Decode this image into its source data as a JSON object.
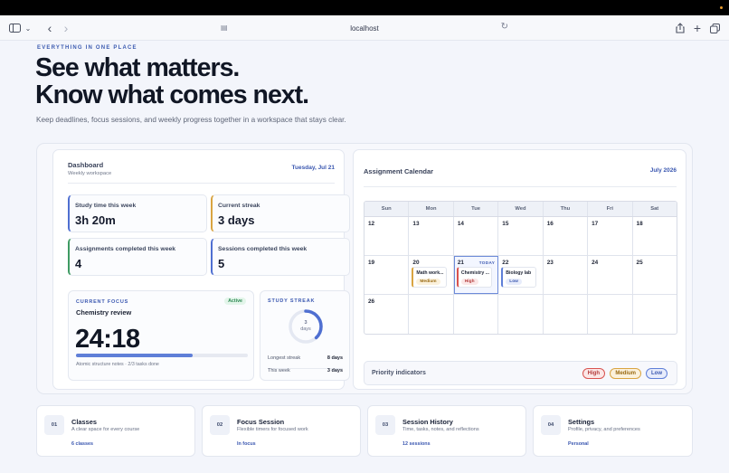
{
  "browser": {
    "url": "localhost"
  },
  "hero": {
    "eyebrow": "EVERYTHING IN ONE PLACE",
    "headline_1": "See what matters.",
    "headline_2": "Know what comes next.",
    "subhead": "Keep deadlines, focus sessions, and weekly progress together in a workspace that stays clear."
  },
  "dashboard": {
    "title": "Dashboard",
    "subtitle": "Weekly workspace",
    "date": "Tuesday, Jul 21",
    "stats": [
      {
        "label": "Study time this week",
        "value": "3h 20m",
        "accent": "#4f6fd1"
      },
      {
        "label": "Current streak",
        "value": "3 days",
        "accent": "#d9a441"
      },
      {
        "label": "Assignments completed this week",
        "value": "4",
        "accent": "#3f9b63"
      },
      {
        "label": "Sessions completed this week",
        "value": "5",
        "accent": "#4f6fd1"
      }
    ],
    "focus": {
      "label": "CURRENT FOCUS",
      "badge": "Active",
      "task": "Chemistry review",
      "timer": "24:18",
      "progress": 0.68,
      "note": "Atomic structure notes · 2/3 tasks done"
    },
    "streak": {
      "label": "STUDY STREAK",
      "ring_value": "3",
      "ring_unit": "days",
      "ring_fraction": 0.38,
      "longest_label": "Longest streak",
      "longest_value": "8 days",
      "week_label": "This week",
      "week_value": "3 days"
    }
  },
  "calendar": {
    "title": "Assignment Calendar",
    "month": "July 2026",
    "weekdays": [
      "Sun",
      "Mon",
      "Tue",
      "Wed",
      "Thu",
      "Fri",
      "Sat"
    ],
    "today_tag": "TODAY",
    "weeks": [
      [
        {
          "d": "12"
        },
        {
          "d": "13"
        },
        {
          "d": "14"
        },
        {
          "d": "15"
        },
        {
          "d": "16"
        },
        {
          "d": "17"
        },
        {
          "d": "18"
        }
      ],
      [
        {
          "d": "19"
        },
        {
          "d": "20",
          "event": {
            "name": "Math work...",
            "priority": "Medium"
          }
        },
        {
          "d": "21",
          "today": true,
          "event": {
            "name": "Chemistry ...",
            "priority": "High"
          }
        },
        {
          "d": "22",
          "event": {
            "name": "Biology lab",
            "priority": "Low"
          }
        },
        {
          "d": "23"
        },
        {
          "d": "24"
        },
        {
          "d": "25"
        }
      ],
      [
        {
          "d": "26"
        },
        {
          "d": ""
        },
        {
          "d": ""
        },
        {
          "d": ""
        },
        {
          "d": ""
        },
        {
          "d": ""
        },
        {
          "d": ""
        }
      ]
    ],
    "priority_label": "Priority indicators",
    "priorities": [
      {
        "name": "High",
        "bg": "#fbe7e7",
        "fg": "#b33a3a",
        "border": "#d9534f"
      },
      {
        "name": "Medium",
        "bg": "#fbf1dc",
        "fg": "#9a6a12",
        "border": "#d9a441"
      },
      {
        "name": "Low",
        "bg": "#e7ecfb",
        "fg": "#3a57b0",
        "border": "#5f7fd8"
      }
    ]
  },
  "nav_cards": [
    {
      "num": "01",
      "title": "Classes",
      "desc": "A clear space for every course",
      "link": "6 classes"
    },
    {
      "num": "02",
      "title": "Focus Session",
      "desc": "Flexible timers for focused work",
      "link": "In focus"
    },
    {
      "num": "03",
      "title": "Session History",
      "desc": "Time, tasks, notes, and reflections",
      "link": "12 sessions"
    },
    {
      "num": "04",
      "title": "Settings",
      "desc": "Profile, privacy, and preferences",
      "link": "Personal"
    }
  ]
}
